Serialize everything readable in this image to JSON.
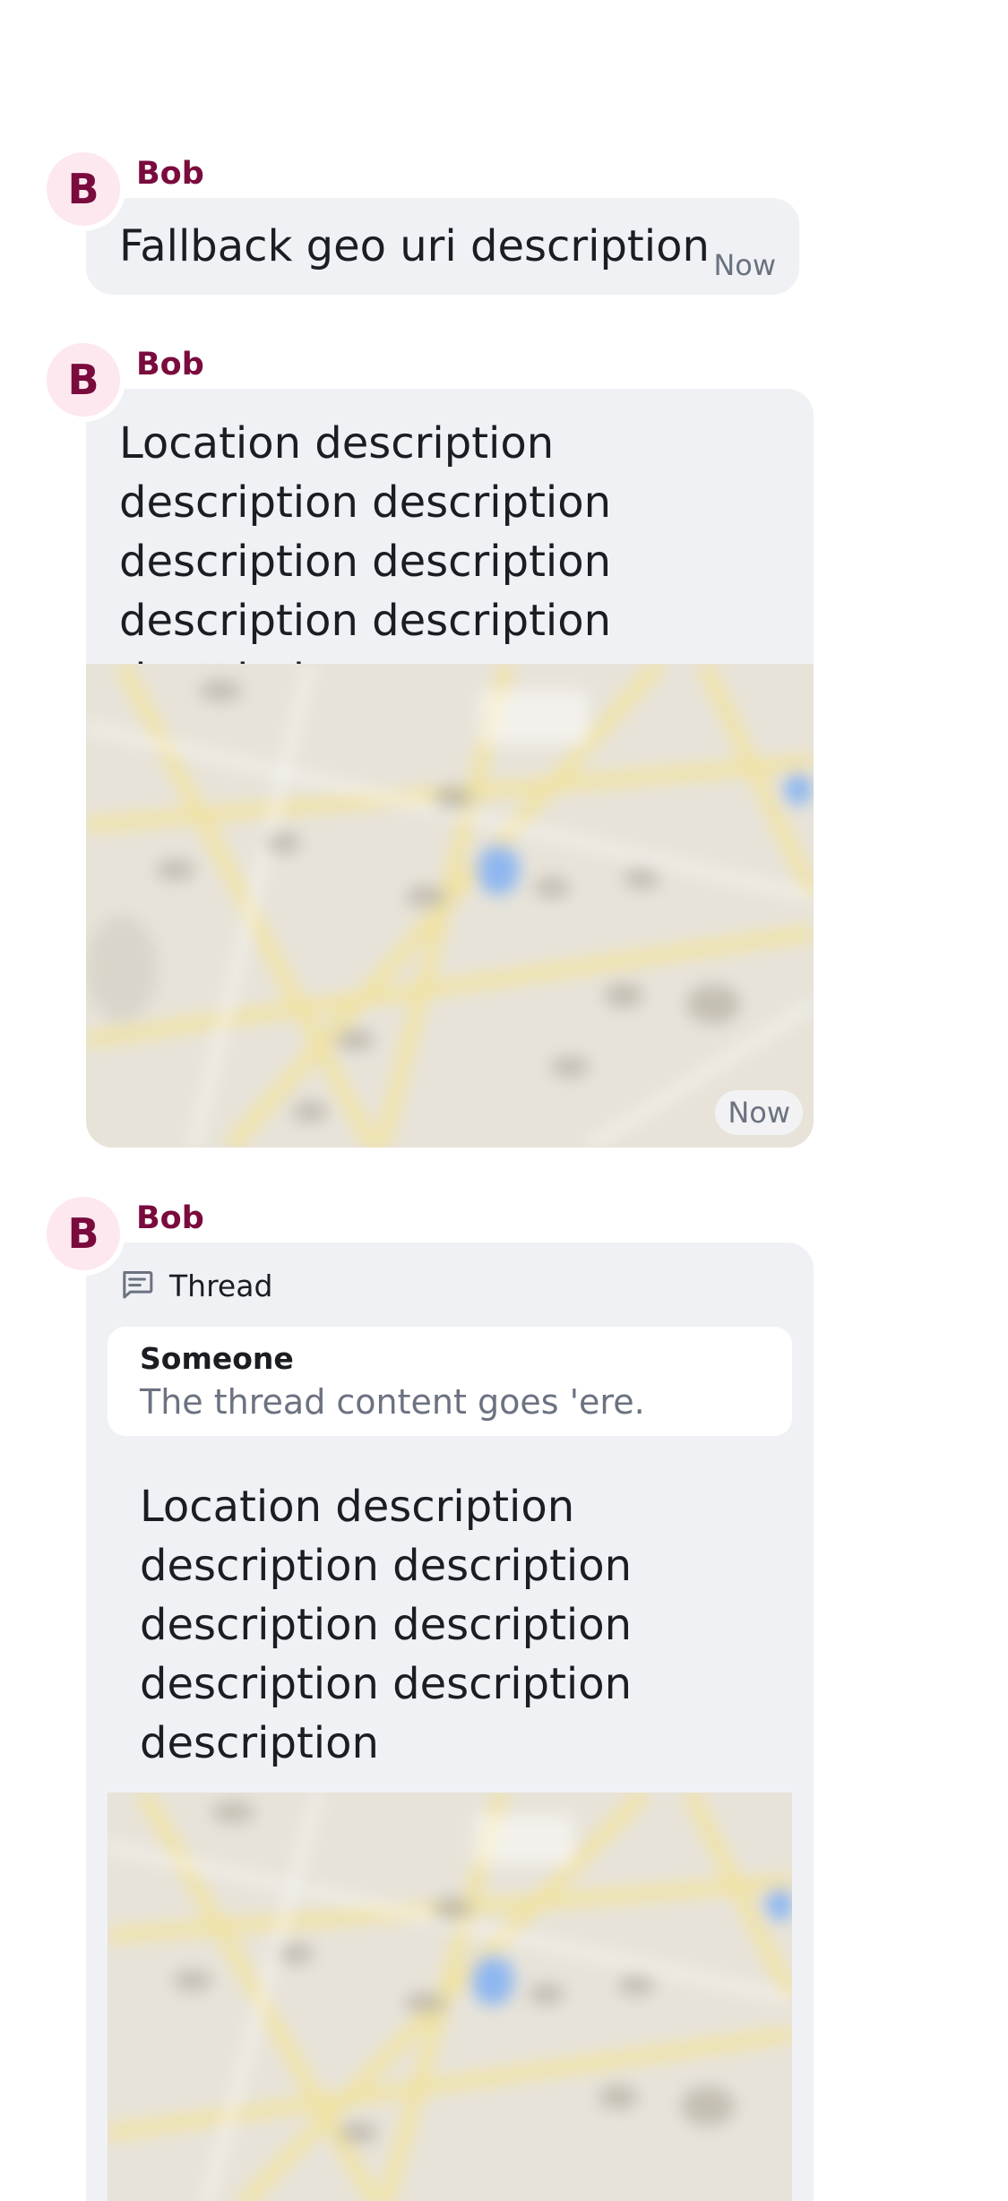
{
  "messages": [
    {
      "avatar_initial": "B",
      "sender": "Bob",
      "text": "Fallback geo uri description",
      "timestamp": "Now"
    },
    {
      "avatar_initial": "B",
      "sender": "Bob",
      "text": "Location description description description description description description description description",
      "timestamp": "Now",
      "has_map": true
    },
    {
      "avatar_initial": "B",
      "sender": "Bob",
      "thread_label": "Thread",
      "thread_icon": "thread-icon",
      "reply": {
        "sender": "Someone",
        "body": "The thread content goes 'ere."
      },
      "text": "Location description description description description description description description description",
      "has_map": true
    }
  ],
  "colors": {
    "sender": "#7a0b3d",
    "avatar_bg": "#fde8ef",
    "bubble_bg": "#f0f1f5",
    "timestamp": "#6b7280"
  }
}
